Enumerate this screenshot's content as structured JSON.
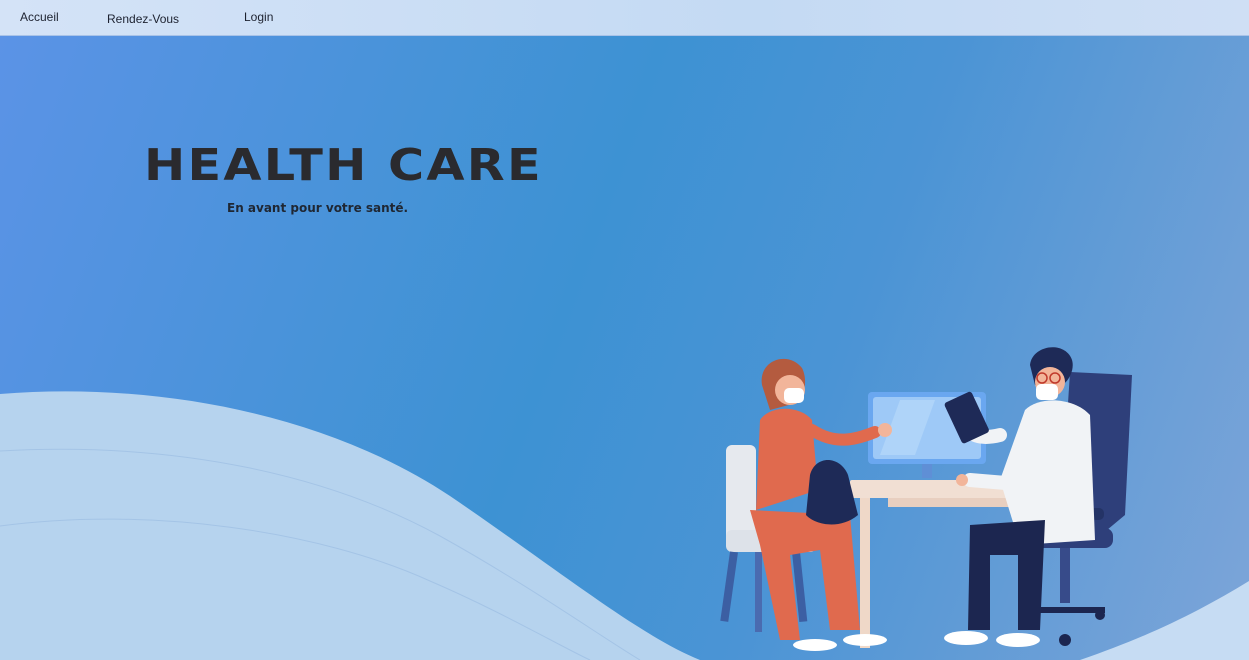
{
  "nav": {
    "home_label": "Accueil",
    "appointments_label": "Rendez-Vous",
    "login_label": "Login"
  },
  "hero": {
    "title": "HEALTH CARE",
    "subtitle": "En avant pour votre santé."
  },
  "colors": {
    "nav_background": "#cfe0f5",
    "hero_blue": "#3d92d3",
    "wave": "#b6d3ee",
    "title_text": "#2a2a2e"
  },
  "illustration": {
    "icon": "doctor-patient-consultation-illustration"
  }
}
